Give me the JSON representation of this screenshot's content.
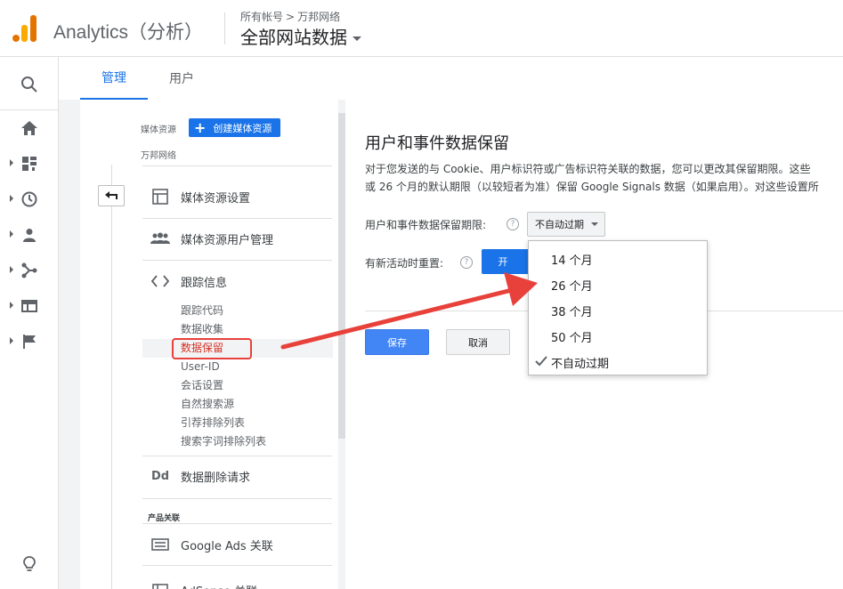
{
  "header": {
    "app_title": "Analytics（分析）",
    "breadcrumb_account": "所有帐号",
    "breadcrumb_property": "万邦网络",
    "view_name": "全部网站数据",
    "brand_colors": [
      "#f9ab00",
      "#e37400"
    ]
  },
  "rail": {
    "icons": [
      "search-icon",
      "home-icon",
      "customization-icon",
      "realtime-icon",
      "audience-icon",
      "acquisition-icon",
      "behavior-icon",
      "conversions-icon",
      "lightbulb-icon"
    ]
  },
  "tabs": [
    {
      "label": "管理",
      "active": true
    },
    {
      "label": "用户",
      "active": false
    }
  ],
  "property": {
    "section_label": "媒体资源",
    "create_label": "创建媒体资源",
    "name": "万邦网络",
    "menu": [
      {
        "label": "媒体资源设置",
        "icon": "property-settings-icon"
      },
      {
        "label": "媒体资源用户管理",
        "icon": "users-icon"
      },
      {
        "label": "跟踪信息",
        "icon": "code-icon"
      }
    ],
    "tracking_sub": [
      "跟踪代码",
      "数据收集",
      "数据保留",
      "User-ID",
      "会话设置",
      "自然搜索源",
      "引荐排除列表",
      "搜索字词排除列表"
    ],
    "deletion_label": "数据删除请求",
    "product_section": "产品关联",
    "google_ads": "Google Ads 关联",
    "adsense": "AdSense 关联"
  },
  "content": {
    "title": "用户和事件数据保留",
    "desc_line1": "对于您发送的与 Cookie、用户标识符或广告标识符关联的数据，您可以更改其保留期限。这些",
    "desc_line2": "或 26 个月的默认期限（以较短者为准）保留 Google Signals 数据（如果启用）。对这些设置所",
    "retention_label": "用户和事件数据保留期限:",
    "retention_value": "不自动过期",
    "reset_label": "有新活动时重置:",
    "toggle_on": "开",
    "help_glyph": "?",
    "save": "保存",
    "cancel": "取消"
  },
  "dropdown": {
    "options": [
      "14 个月",
      "26 个月",
      "38 个月",
      "50 个月",
      "不自动过期"
    ],
    "selected": "不自动过期"
  },
  "annotation": {
    "highlight_color": "#e8413b",
    "accent": "#1a73e8"
  }
}
